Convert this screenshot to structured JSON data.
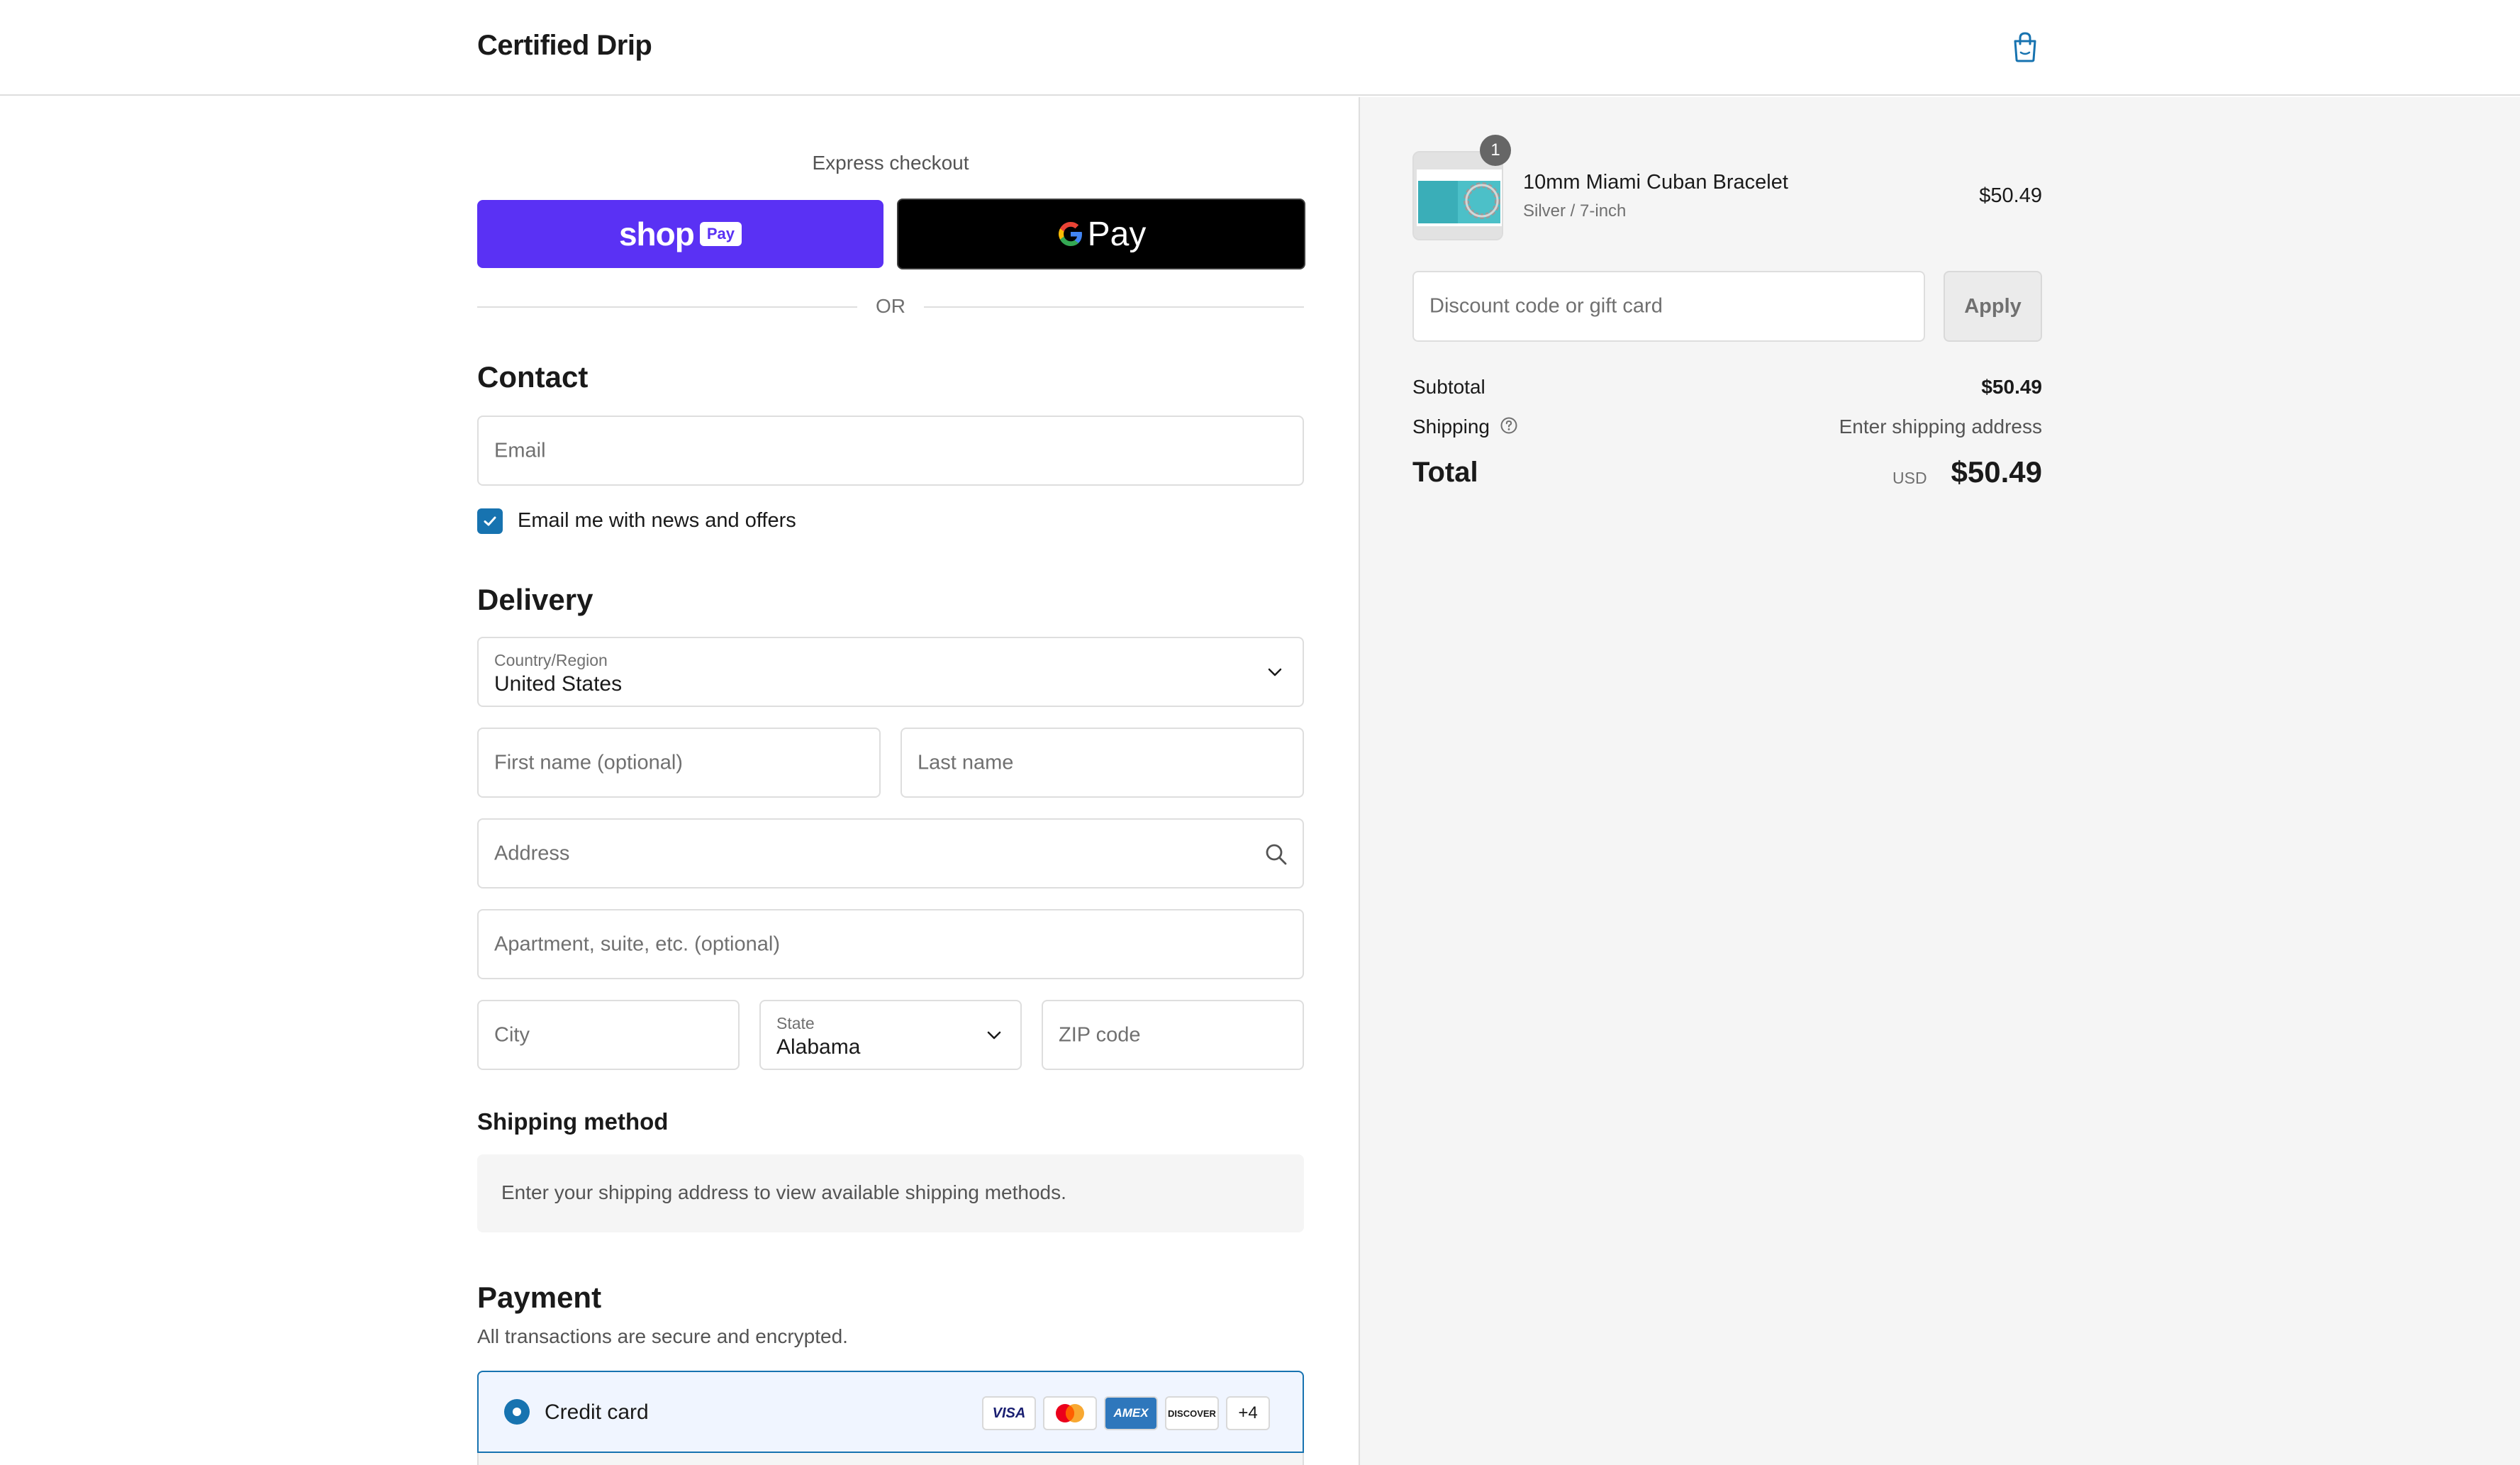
{
  "header": {
    "brand": "Certified Drip"
  },
  "express": {
    "label": "Express checkout",
    "shop_word": "shop",
    "shop_badge": "Pay",
    "gpay_word": "Pay",
    "or_text": "OR"
  },
  "contact": {
    "title": "Contact",
    "email_placeholder": "Email",
    "newsletter_label": "Email me with news and offers",
    "newsletter_checked": true
  },
  "delivery": {
    "title": "Delivery",
    "country_label": "Country/Region",
    "country_value": "United States",
    "first_name_placeholder": "First name (optional)",
    "last_name_placeholder": "Last name",
    "address_placeholder": "Address",
    "apartment_placeholder": "Apartment, suite, etc. (optional)",
    "city_placeholder": "City",
    "state_label": "State",
    "state_value": "Alabama",
    "zip_placeholder": "ZIP code"
  },
  "shipping_method": {
    "title": "Shipping method",
    "notice": "Enter your shipping address to view available shipping methods."
  },
  "payment": {
    "title": "Payment",
    "subtitle": "All transactions are secure and encrypted.",
    "method_label": "Credit card",
    "cards": [
      "VISA",
      "mastercard",
      "AMEX",
      "DISCOVER"
    ],
    "more_cards": "+4"
  },
  "summary": {
    "item": {
      "name": "10mm Miami Cuban Bracelet",
      "variant": "Silver / 7-inch",
      "price": "$50.49",
      "quantity": "1"
    },
    "discount_placeholder": "Discount code or gift card",
    "apply_label": "Apply",
    "subtotal_label": "Subtotal",
    "subtotal_value": "$50.49",
    "shipping_label": "Shipping",
    "shipping_value": "Enter shipping address",
    "total_label": "Total",
    "currency": "USD",
    "total_value": "$50.49"
  },
  "colors": {
    "shop_pay": "#5a31f4",
    "accent": "#1773b0",
    "summary_bg": "#f5f5f5"
  },
  "icons": {
    "bag": "shopping-bag-icon",
    "search": "search-icon",
    "chevron": "chevron-down-icon",
    "help": "question-circle-icon"
  }
}
